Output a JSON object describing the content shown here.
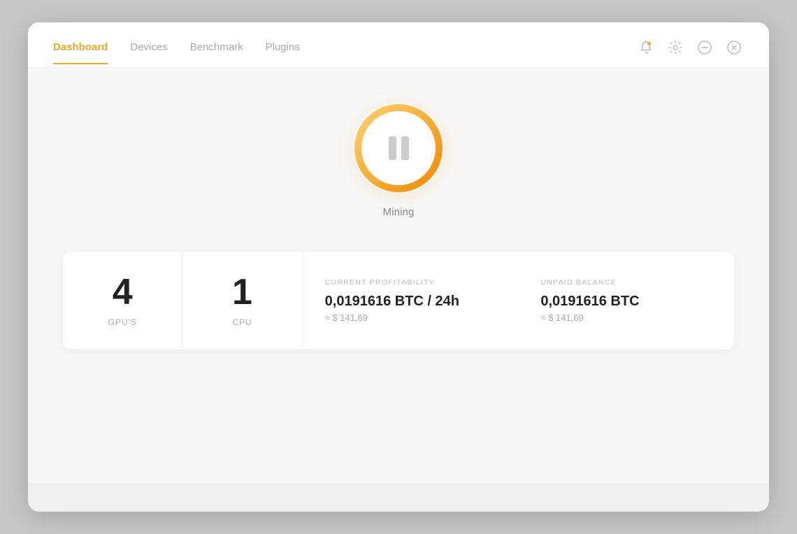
{
  "nav": {
    "tabs": [
      {
        "id": "dashboard",
        "label": "Dashboard",
        "active": true
      },
      {
        "id": "devices",
        "label": "Devices",
        "active": false
      },
      {
        "id": "benchmark",
        "label": "Benchmark",
        "active": false
      },
      {
        "id": "plugins",
        "label": "Plugins",
        "active": false
      }
    ],
    "icons": [
      {
        "id": "bell",
        "symbol": "🔔",
        "label": "Notifications"
      },
      {
        "id": "gear",
        "symbol": "⚙",
        "label": "Settings"
      },
      {
        "id": "minus",
        "symbol": "⊖",
        "label": "Minimize"
      },
      {
        "id": "close",
        "symbol": "⊗",
        "label": "Close"
      }
    ]
  },
  "mining": {
    "status_label": "Mining"
  },
  "stats": [
    {
      "id": "gpus",
      "number": "4",
      "label": "GPU'S"
    },
    {
      "id": "cpu",
      "number": "1",
      "label": "CPU"
    },
    {
      "id": "profitability",
      "section_label": "CURRENT PROFITABILITY",
      "main_value": "0,0191616 BTC / 24h",
      "sub_value": "≈ $ 141,69"
    },
    {
      "id": "balance",
      "section_label": "UNPAID BALANCE",
      "main_value": "0,0191616 BTC",
      "sub_value": "≈ $ 141,69"
    }
  ],
  "colors": {
    "accent": "#f5a623",
    "text_dark": "#222222",
    "text_muted": "#aaaaaa",
    "border": "#f0f0f0"
  }
}
